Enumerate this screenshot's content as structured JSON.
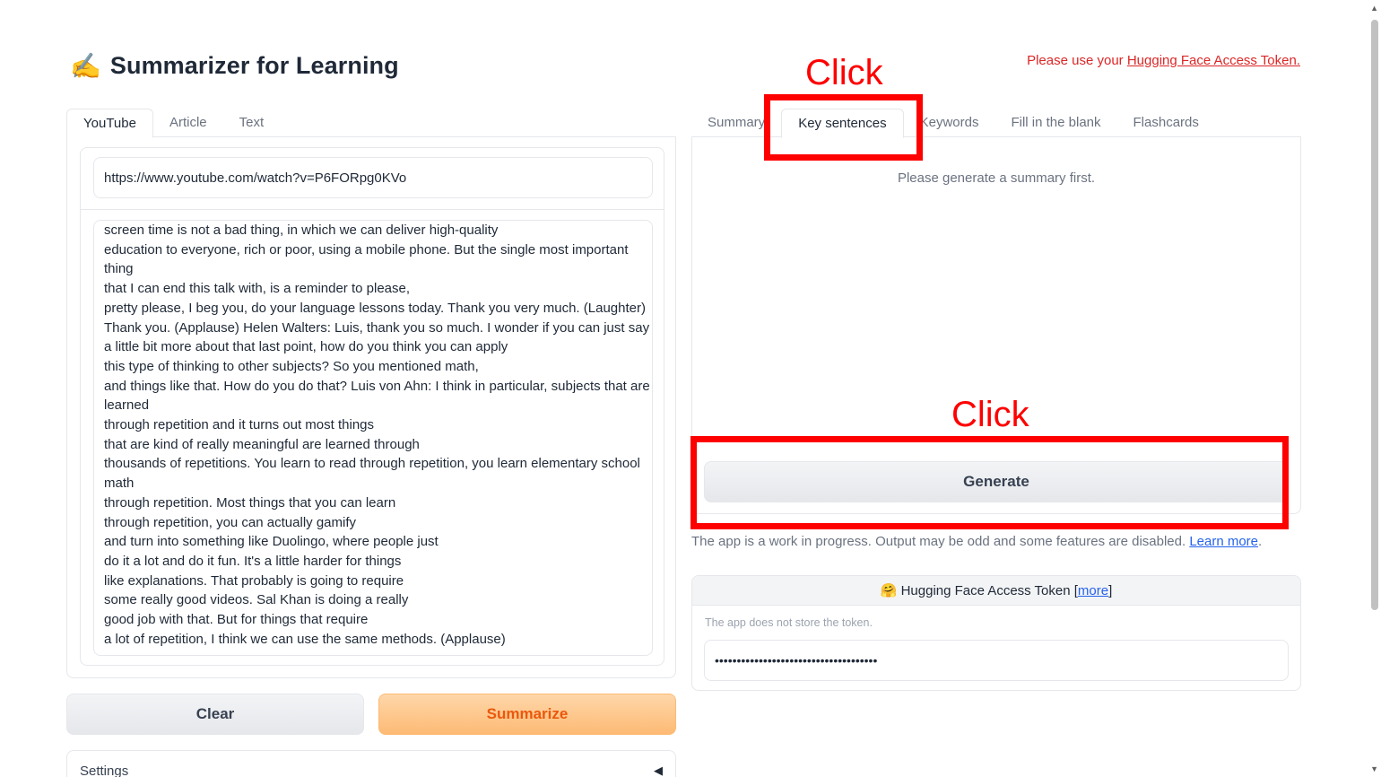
{
  "header": {
    "title_emoji": "✍️",
    "title": "Summarizer for Learning",
    "token_note_prefix": "Please use your ",
    "token_note_link": "Hugging Face Access Token."
  },
  "left_tabs": [
    "YouTube",
    "Article",
    "Text"
  ],
  "youtube": {
    "url_value": "https://www.youtube.com/watch?v=P6FORpg0KVo",
    "transcript_lines": [
      "screen time is not a bad thing, in which we can deliver high-quality",
      "education to everyone, rich or poor, using a mobile phone. But the single most important",
      "thing",
      "that I can end this talk with, is a reminder to please,",
      "pretty please, I beg you, do your language lessons today. Thank you very much. (Laughter)",
      "Thank you. (Applause) Helen Walters: Luis, thank you so much. I wonder if you can just say",
      "a little bit more about that last point, how do you think you can apply",
      "this type of thinking to other subjects? So you mentioned math,",
      "and things like that. How do you do that? Luis von Ahn: I think in particular, subjects that are",
      "learned",
      "through repetition and it turns out most things",
      "that are kind of really meaningful are learned through",
      "thousands of repetitions. You learn to read through repetition, you learn elementary school",
      "math",
      "through repetition. Most things that you can learn",
      "through repetition, you can actually gamify",
      "and turn into something like Duolingo, where people just",
      "do it a lot and do it fun. It's a little harder for things",
      "like explanations. That probably is going to require",
      "some really good videos. Sal Khan is doing a really",
      "good job with that. But for things that require",
      "a lot of repetition, I think we can use the same methods. (Applause)"
    ]
  },
  "buttons": {
    "clear": "Clear",
    "summarize": "Summarize",
    "generate": "Generate"
  },
  "settings_label": "Settings",
  "right_tabs": [
    "Summary",
    "Key sentences",
    "Keywords",
    "Fill in the blank",
    "Flashcards"
  ],
  "right_panel": {
    "placeholder": "Please generate a summary first."
  },
  "footer_note": {
    "text": "The app is a work in progress. Output may be odd and some features are disabled. ",
    "link": "Learn more",
    "suffix": "."
  },
  "token_box": {
    "emoji": "🤗",
    "label": "Hugging Face Access Token ",
    "more_link": "more",
    "info": "The app does not store the token.",
    "value": "•••••••••••••••••••••••••••••••••••••"
  },
  "annotations": {
    "click_1": "Click",
    "click_2": "Click",
    "color": "#ff0000"
  },
  "colors": {
    "accent_orange": "#ea580c",
    "link_blue": "#2563eb",
    "warning_red": "#dc2626"
  }
}
